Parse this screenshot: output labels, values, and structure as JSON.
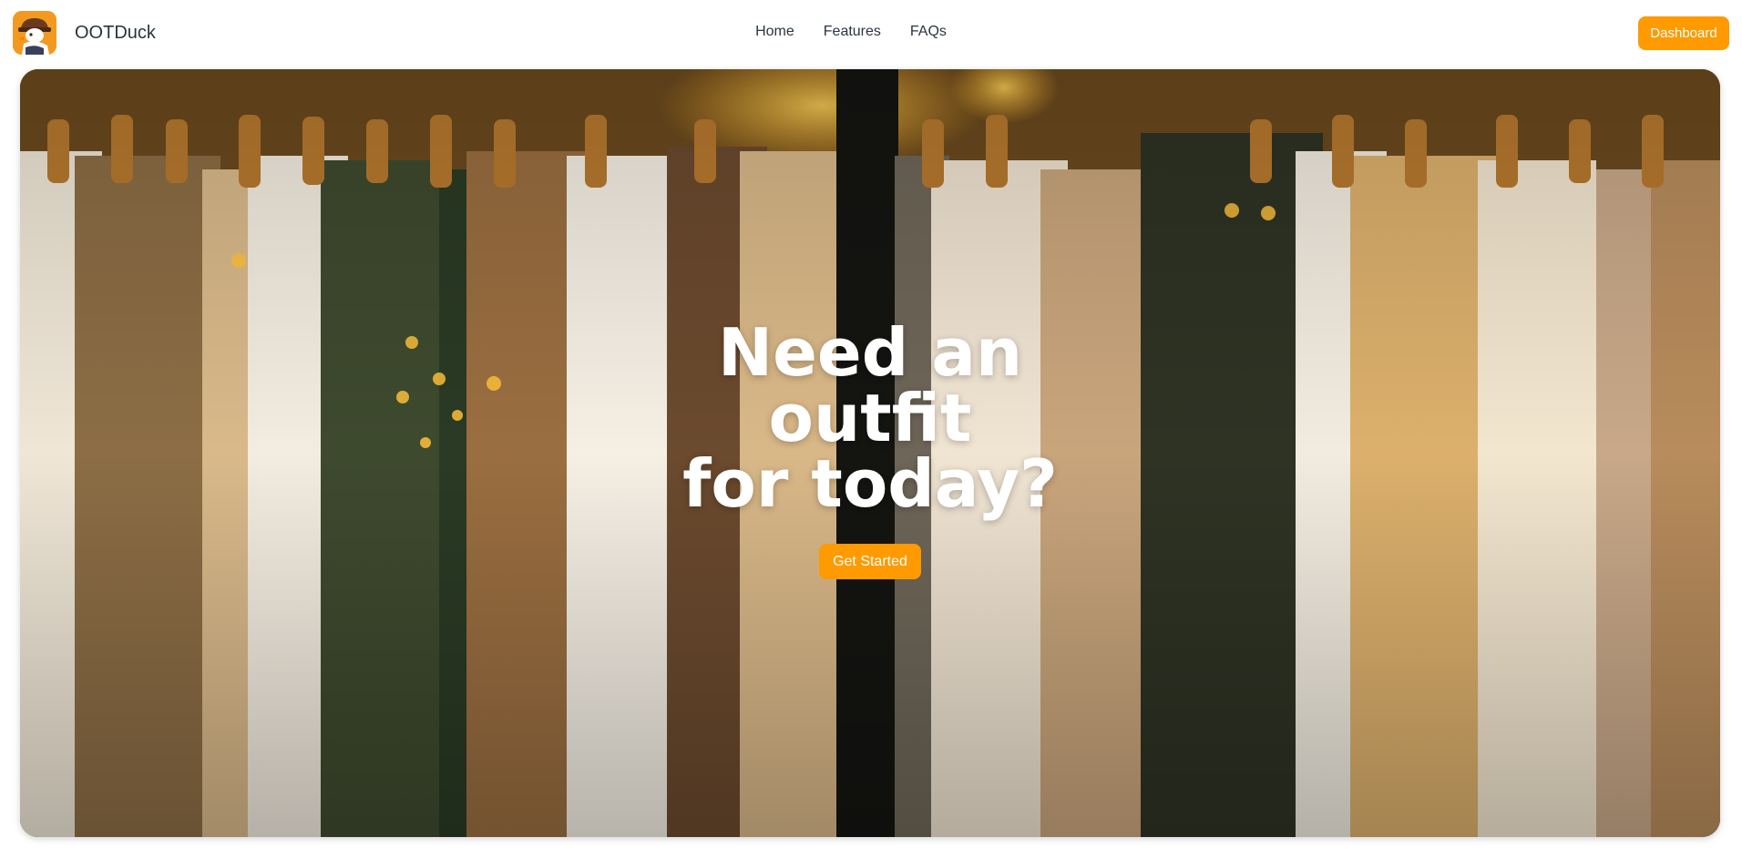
{
  "app": {
    "brand_name": "OOTDuck",
    "logo_icon": "duck-detective-icon"
  },
  "nav": {
    "links": [
      "Home",
      "Features",
      "FAQs"
    ],
    "dashboard_label": "Dashboard"
  },
  "hero": {
    "title_line1": "Need an outfit",
    "title_line2": "for today?",
    "cta_label": "Get Started",
    "background": "clothing-rack-photo"
  },
  "colors": {
    "accent": "#ff9a00",
    "logo_bg": "#f29a1f",
    "nav_text": "#2b3440",
    "hero_text": "#ffffff"
  }
}
